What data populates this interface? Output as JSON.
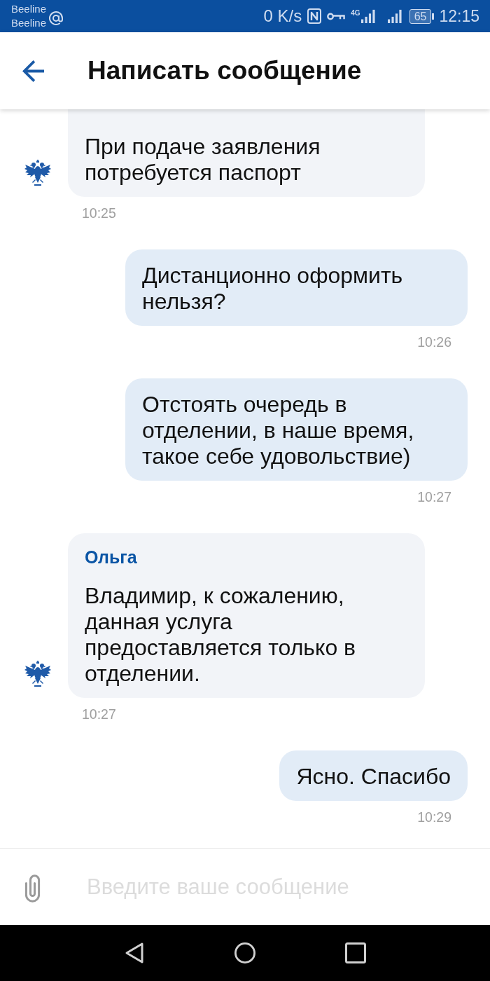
{
  "status_bar": {
    "carriers": [
      "Beeline",
      "Beeline"
    ],
    "speed": "0 K/s",
    "network": "4G",
    "battery": "65",
    "time": "12:15"
  },
  "header": {
    "title": "Написать сообщение"
  },
  "messages": [
    {
      "kind": "incoming",
      "text": "При подаче заявления потребуется паспорт",
      "time": "10:25"
    },
    {
      "kind": "outgoing",
      "text": "Дистанционно оформить нельзя?",
      "time": "10:26"
    },
    {
      "kind": "outgoing",
      "text": "Отстоять очередь в отделении, в наше время, такое себе удовольствие)",
      "time": "10:27"
    },
    {
      "kind": "incoming",
      "sender": "Ольга",
      "text": "Владимир, к сожалению, данная услуга предоставляется только в отделении.",
      "time": "10:27"
    },
    {
      "kind": "outgoing",
      "text": "Ясно. Спасибо",
      "time": "10:29"
    }
  ],
  "composer": {
    "placeholder": "Введите ваше сообщение"
  }
}
